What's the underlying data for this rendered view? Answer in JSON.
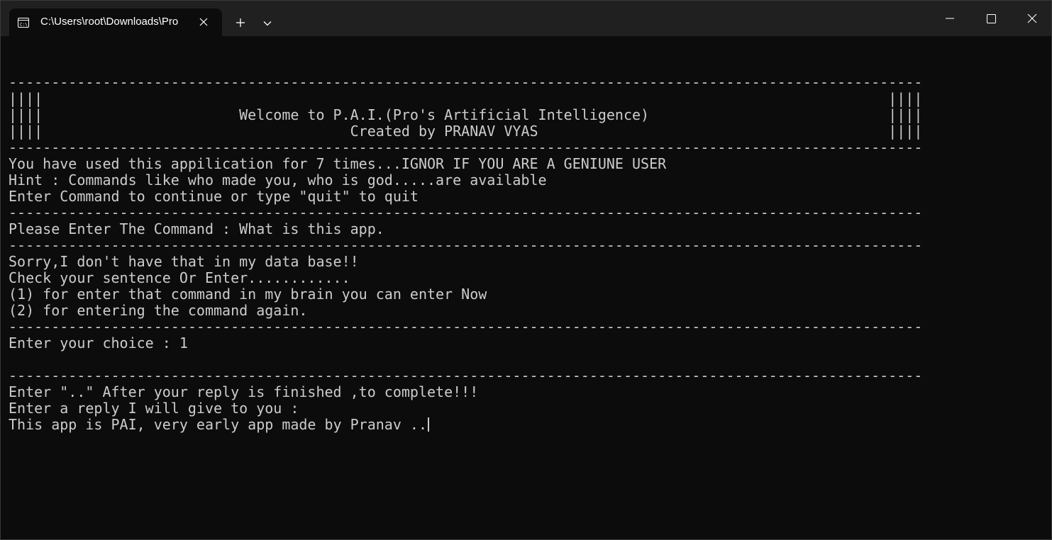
{
  "window": {
    "tab_title": "C:\\Users\\root\\Downloads\\Pro",
    "icons": {
      "tab": "terminal-icon",
      "close_tab": "close-icon",
      "new_tab": "plus-icon",
      "dropdown": "chevron-down-icon",
      "minimize": "minimize-icon",
      "maximize": "maximize-icon",
      "close_window": "close-icon"
    }
  },
  "colors": {
    "terminal_bg": "#0c0c0c",
    "text": "#cccccc",
    "tabbar_bg": "#202020",
    "active_tab_bg": "#0c0c0c"
  },
  "terminal": {
    "lines": [
      "",
      "-----------------------------------------------------------------------------------------------------------",
      "||||                                                                                                   ||||",
      "||||                       Welcome to P.A.I.(Pro's Artificial Intelligence)                            ||||",
      "||||                                    Created by PRANAV VYAS                                         ||||",
      "-----------------------------------------------------------------------------------------------------------",
      "You have used this appilication for 7 times...IGNOR IF YOU ARE A GENIUNE USER",
      "Hint : Commands like who made you, who is god.....are available",
      "Enter Command to continue or type \"quit\" to quit",
      "-----------------------------------------------------------------------------------------------------------",
      "Please Enter The Command : What is this app.",
      "-----------------------------------------------------------------------------------------------------------",
      "Sorry,I don't have that in my data base!!",
      "Check your sentence Or Enter............",
      "(1) for enter that command in my brain you can enter Now",
      "(2) for entering the command again.",
      "-----------------------------------------------------------------------------------------------------------",
      "Enter your choice : 1",
      "",
      "-----------------------------------------------------------------------------------------------------------",
      "Enter \"..\" After your reply is finished ,to complete!!!",
      "Enter a reply I will give to you :",
      "This app is PAI, very early app made by Pranav .."
    ]
  }
}
